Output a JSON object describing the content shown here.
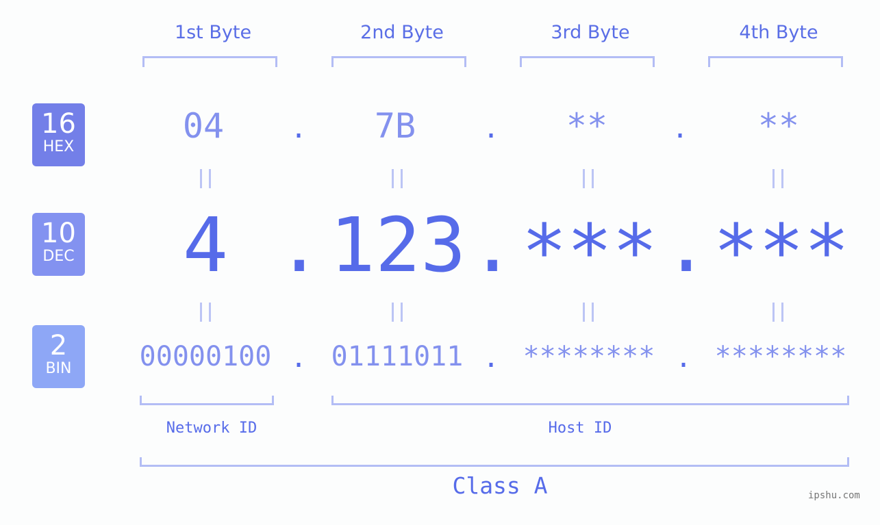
{
  "byte_headers": [
    "1st Byte",
    "2nd Byte",
    "3rd Byte",
    "4th Byte"
  ],
  "bases": [
    {
      "num": "16",
      "label": "HEX",
      "color": "#737fe8"
    },
    {
      "num": "10",
      "label": "DEC",
      "color": "#8392f0"
    },
    {
      "num": "2",
      "label": "BIN",
      "color": "#8ea7f6"
    }
  ],
  "hex": [
    "04",
    "7B",
    "**",
    "**"
  ],
  "dec": [
    "4",
    "123",
    "***",
    "***"
  ],
  "bin": [
    "00000100",
    "01111011",
    "********",
    "********"
  ],
  "separator": ".",
  "network_label": "Network ID",
  "host_label": "Host ID",
  "class_label": "Class A",
  "watermark": "ipshu.com"
}
